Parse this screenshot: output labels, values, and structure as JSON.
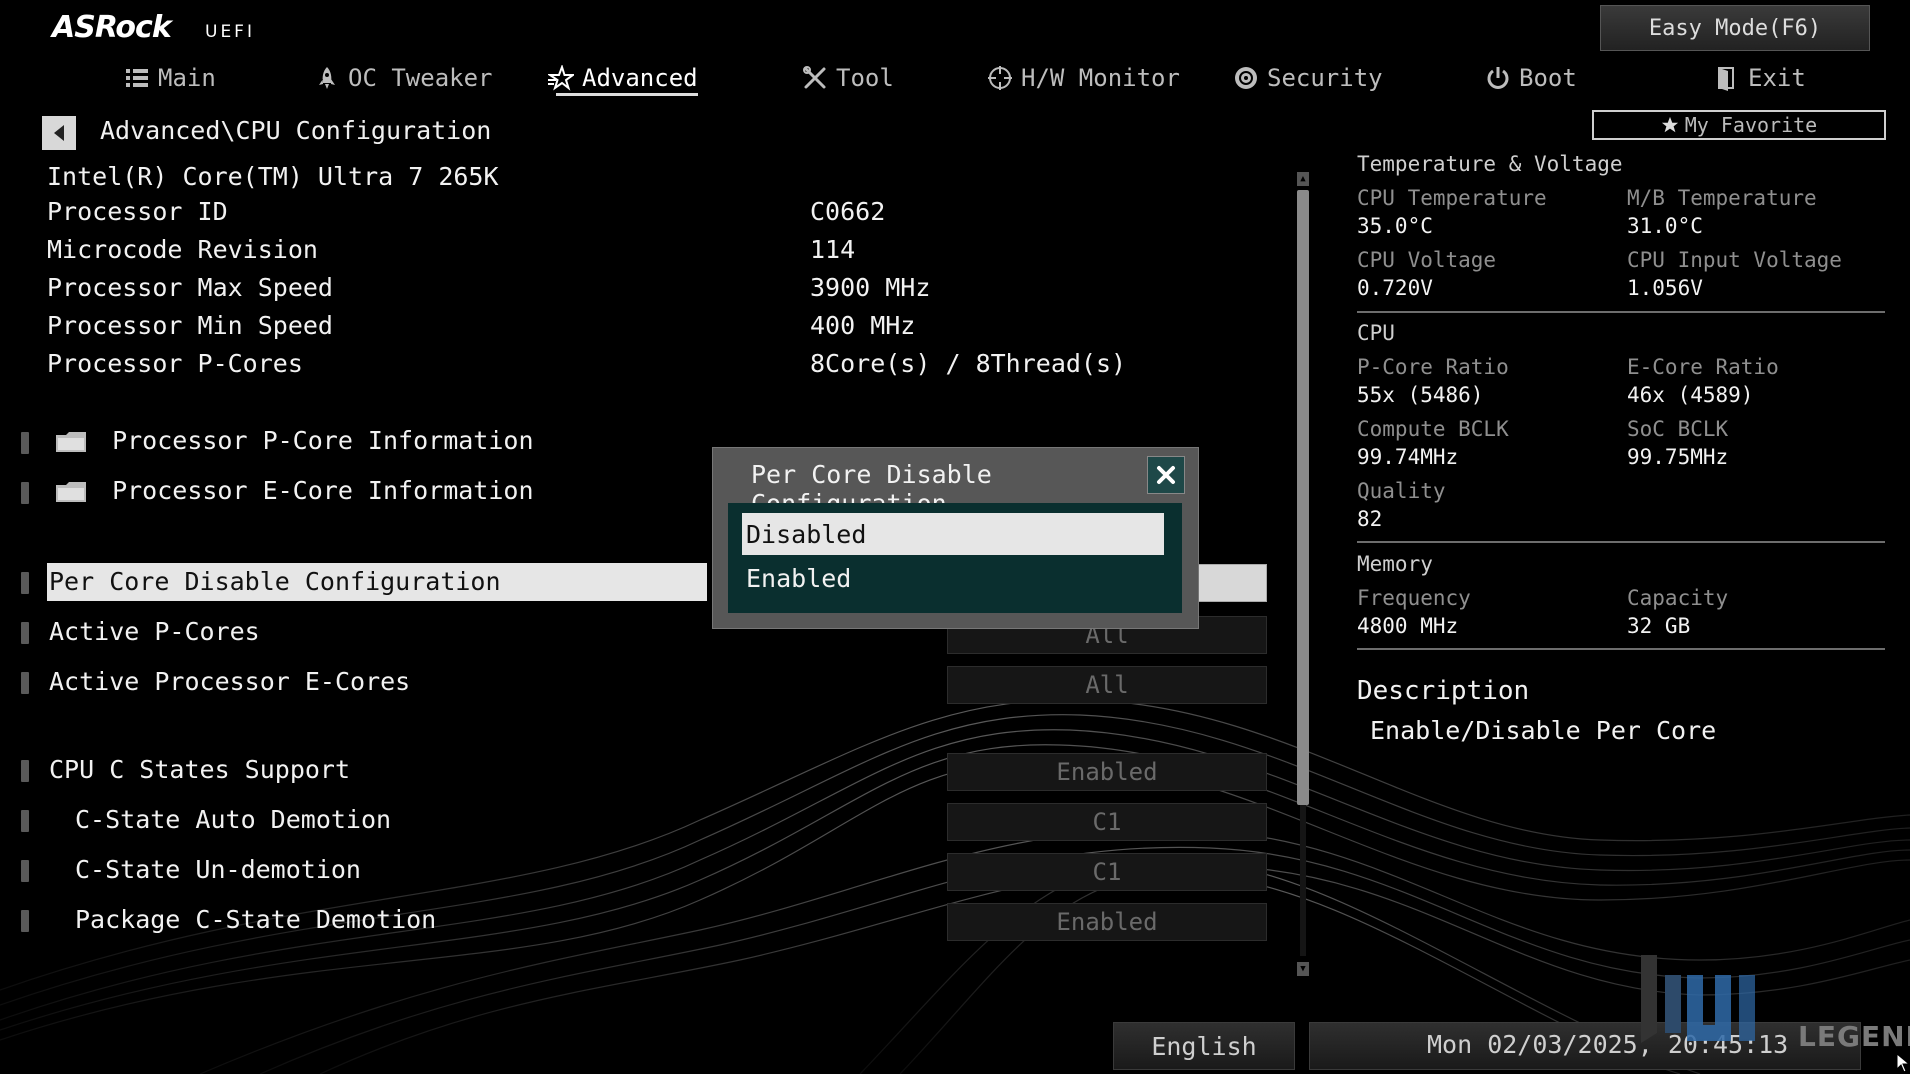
{
  "header": {
    "brand": "ASRock",
    "brand_sub": "UEFI",
    "easy_mode": "Easy Mode(F6)",
    "my_favorite": "My Favorite",
    "tabs": [
      {
        "label": "Main",
        "icon": "list-icon"
      },
      {
        "label": "OC Tweaker",
        "icon": "rocket-icon"
      },
      {
        "label": "Advanced",
        "icon": "star-icon",
        "active": true
      },
      {
        "label": "Tool",
        "icon": "tools-icon"
      },
      {
        "label": "H/W Monitor",
        "icon": "crosshair-icon"
      },
      {
        "label": "Security",
        "icon": "shield-icon"
      },
      {
        "label": "Boot",
        "icon": "power-icon"
      },
      {
        "label": "Exit",
        "icon": "exit-icon"
      }
    ]
  },
  "breadcrumb": "Advanced\\CPU Configuration",
  "cpu_name": "Intel(R) Core(TM) Ultra 7 265K",
  "info_rows": [
    {
      "label": "Processor ID",
      "value": "C0662"
    },
    {
      "label": "Microcode Revision",
      "value": "114"
    },
    {
      "label": "Processor Max Speed",
      "value": "3900 MHz"
    },
    {
      "label": "Processor Min Speed",
      "value": "400 MHz"
    },
    {
      "label": "Processor P-Cores",
      "value": "8Core(s) / 8Thread(s)"
    }
  ],
  "submenus": [
    {
      "label": "Processor P-Core Information"
    },
    {
      "label": "Processor E-Core Information"
    }
  ],
  "settings": [
    {
      "label": "Per Core Disable Configuration",
      "value": ""
    },
    {
      "label": "Active P-Cores",
      "value": "All"
    },
    {
      "label": "Active Processor E-Cores",
      "value": "All"
    },
    {
      "label": "CPU C States Support",
      "value": "Enabled"
    },
    {
      "label": "C-State Auto Demotion",
      "value": "C1"
    },
    {
      "label": "C-State Un-demotion",
      "value": "C1"
    },
    {
      "label": "Package C-State Demotion",
      "value": "Enabled"
    }
  ],
  "popup": {
    "title": "Per Core Disable Configuration",
    "options": [
      "Disabled",
      "Enabled"
    ],
    "selected_index": 0
  },
  "monitor": {
    "temp_volt_title": "Temperature & Voltage",
    "cpu_temp_label": "CPU Temperature",
    "cpu_temp": "35.0°C",
    "mb_temp_label": "M/B Temperature",
    "mb_temp": "31.0°C",
    "cpu_volt_label": "CPU Voltage",
    "cpu_volt": "0.720V",
    "cpu_in_volt_label": "CPU Input Voltage",
    "cpu_in_volt": "1.056V",
    "cpu_title": "CPU",
    "pcore_ratio_label": "P-Core Ratio",
    "pcore_ratio": "55x (5486)",
    "ecore_ratio_label": "E-Core Ratio",
    "ecore_ratio": "46x (4589)",
    "compute_bclk_label": "Compute BCLK",
    "compute_bclk": "99.74MHz",
    "soc_bclk_label": "SoC BCLK",
    "soc_bclk": "99.75MHz",
    "quality_label": "Quality",
    "quality": "82",
    "memory_title": "Memory",
    "freq_label": "Frequency",
    "freq": "4800 MHz",
    "capacity_label": "Capacity",
    "capacity": "32 GB"
  },
  "description": {
    "title": "Description",
    "text": "Enable/Disable Per Core"
  },
  "footer": {
    "language": "English",
    "datetime": "Mon 02/03/2025, 20:45:13",
    "watermark": "LEGEND"
  },
  "colors": {
    "background": "#000000",
    "popup_list_bg": "#0a2f2f",
    "highlight": "#e6e6e6"
  }
}
